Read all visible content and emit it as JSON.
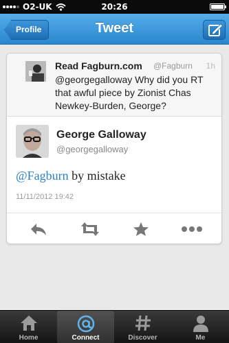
{
  "status_bar": {
    "carrier": "O2-UK",
    "time": "20:26"
  },
  "nav": {
    "back_label": "Profile",
    "title": "Tweet"
  },
  "reply_context": {
    "name": "Read Fagburn.com",
    "handle": "@Fagburn",
    "time": "1h",
    "text": "@georgegalloway Why did you RT that awful piece by Zionist Chas Newkey-Burden, George?"
  },
  "tweet": {
    "author_name": "George Galloway",
    "author_handle": "@georgegalloway",
    "mention": "@Fagburn",
    "body": " by mistake",
    "date": "11/11/2012 19:42"
  },
  "actions": {
    "reply_icon": "reply-icon",
    "retweet_icon": "retweet-icon",
    "favorite_icon": "star-icon",
    "more_icon": "more-icon"
  },
  "tabs": [
    {
      "label": "Home",
      "icon": "home-icon"
    },
    {
      "label": "Connect",
      "icon": "at-icon"
    },
    {
      "label": "Discover",
      "icon": "hash-icon"
    },
    {
      "label": "Me",
      "icon": "person-icon"
    }
  ],
  "colors": {
    "nav_blue": "#2a86cf",
    "link_blue": "#2a7fc6",
    "tab_bar": "#1a1a1a"
  }
}
